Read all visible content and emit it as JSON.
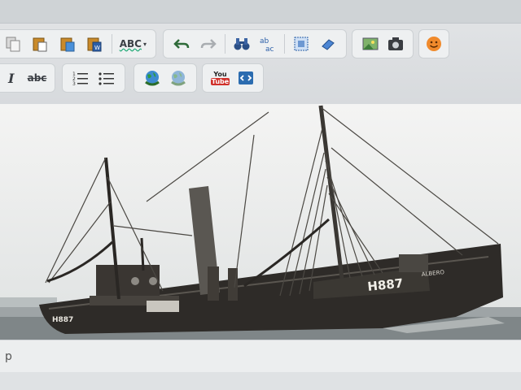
{
  "toolbar": {
    "spellcheck_label": "ABC",
    "strike_label": "abc",
    "youtube_top": "You",
    "youtube_bottom": "Tube"
  },
  "photo": {
    "hull_number": "H887",
    "bow_number": "H887",
    "name_text": "ALBERO"
  },
  "status": {
    "path": "p"
  },
  "colors": {
    "toolbar_bg": "#e3e5e7",
    "group_bg": "#eef0f1",
    "accent_blue": "#2b6cb0",
    "emoji_orange": "#f08a2c"
  }
}
